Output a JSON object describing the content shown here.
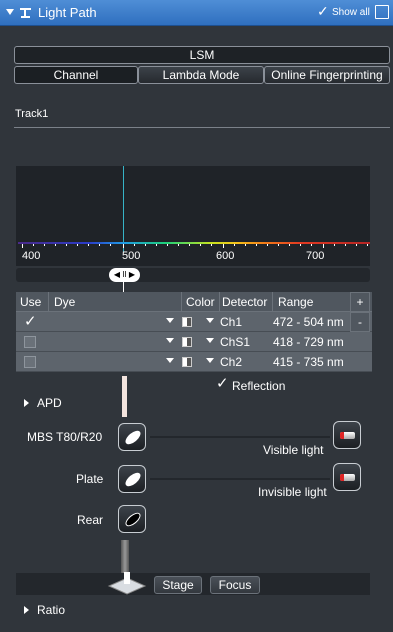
{
  "header": {
    "title": "Light Path",
    "show_all_label": "Show all",
    "check_symbol": "✓"
  },
  "tabs": {
    "top": "LSM",
    "modes": [
      "Channel",
      "Lambda Mode",
      "Online Fingerprinting"
    ]
  },
  "track_label": "Track1",
  "spectrum": {
    "wavelength_labels": [
      "400",
      "500",
      "600",
      "700"
    ],
    "slider_knob": "◀ II ▶"
  },
  "table": {
    "headers": {
      "use": "Use",
      "dye": "Dye",
      "color": "Color",
      "detector": "Detector",
      "range": "Range",
      "add": "+"
    },
    "remove": "-",
    "rows": [
      {
        "checked": true,
        "detector": "Ch1",
        "range": "472 - 504 nm"
      },
      {
        "checked": false,
        "detector": "ChS1",
        "range": "418 - 729 nm"
      },
      {
        "checked": false,
        "detector": "Ch2",
        "range": "415 - 735 nm"
      }
    ]
  },
  "reflection_label": "Reflection",
  "apd_label": "APD",
  "mbs_label": "MBS T80/R20",
  "plate_label": "Plate",
  "rear_label": "Rear",
  "visible_light_label": "Visible light",
  "invisible_light_label": "Invisible light",
  "stage_button": "Stage",
  "focus_button": "Focus",
  "ratio_label": "Ratio",
  "colors": {
    "header_blue": "#3a7fcf",
    "panel": "#30353b",
    "table_row": "#5d646c",
    "laser_red": "#e02424"
  }
}
